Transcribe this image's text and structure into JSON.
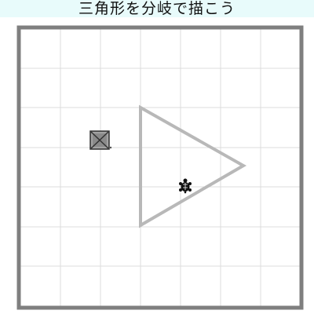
{
  "title": "三角形を分岐で描こう",
  "colors": {
    "title_bg": "#e8fbfb",
    "frame": "#7f7f7f",
    "grid": "#dcdcdc",
    "triangle": "#b8b8b8",
    "box": "#8a8a8a",
    "turtle": "#111111"
  },
  "grid": {
    "divisions": 7
  },
  "icons": {
    "box": "crossed-box-icon",
    "turtle": "turtle-icon"
  }
}
